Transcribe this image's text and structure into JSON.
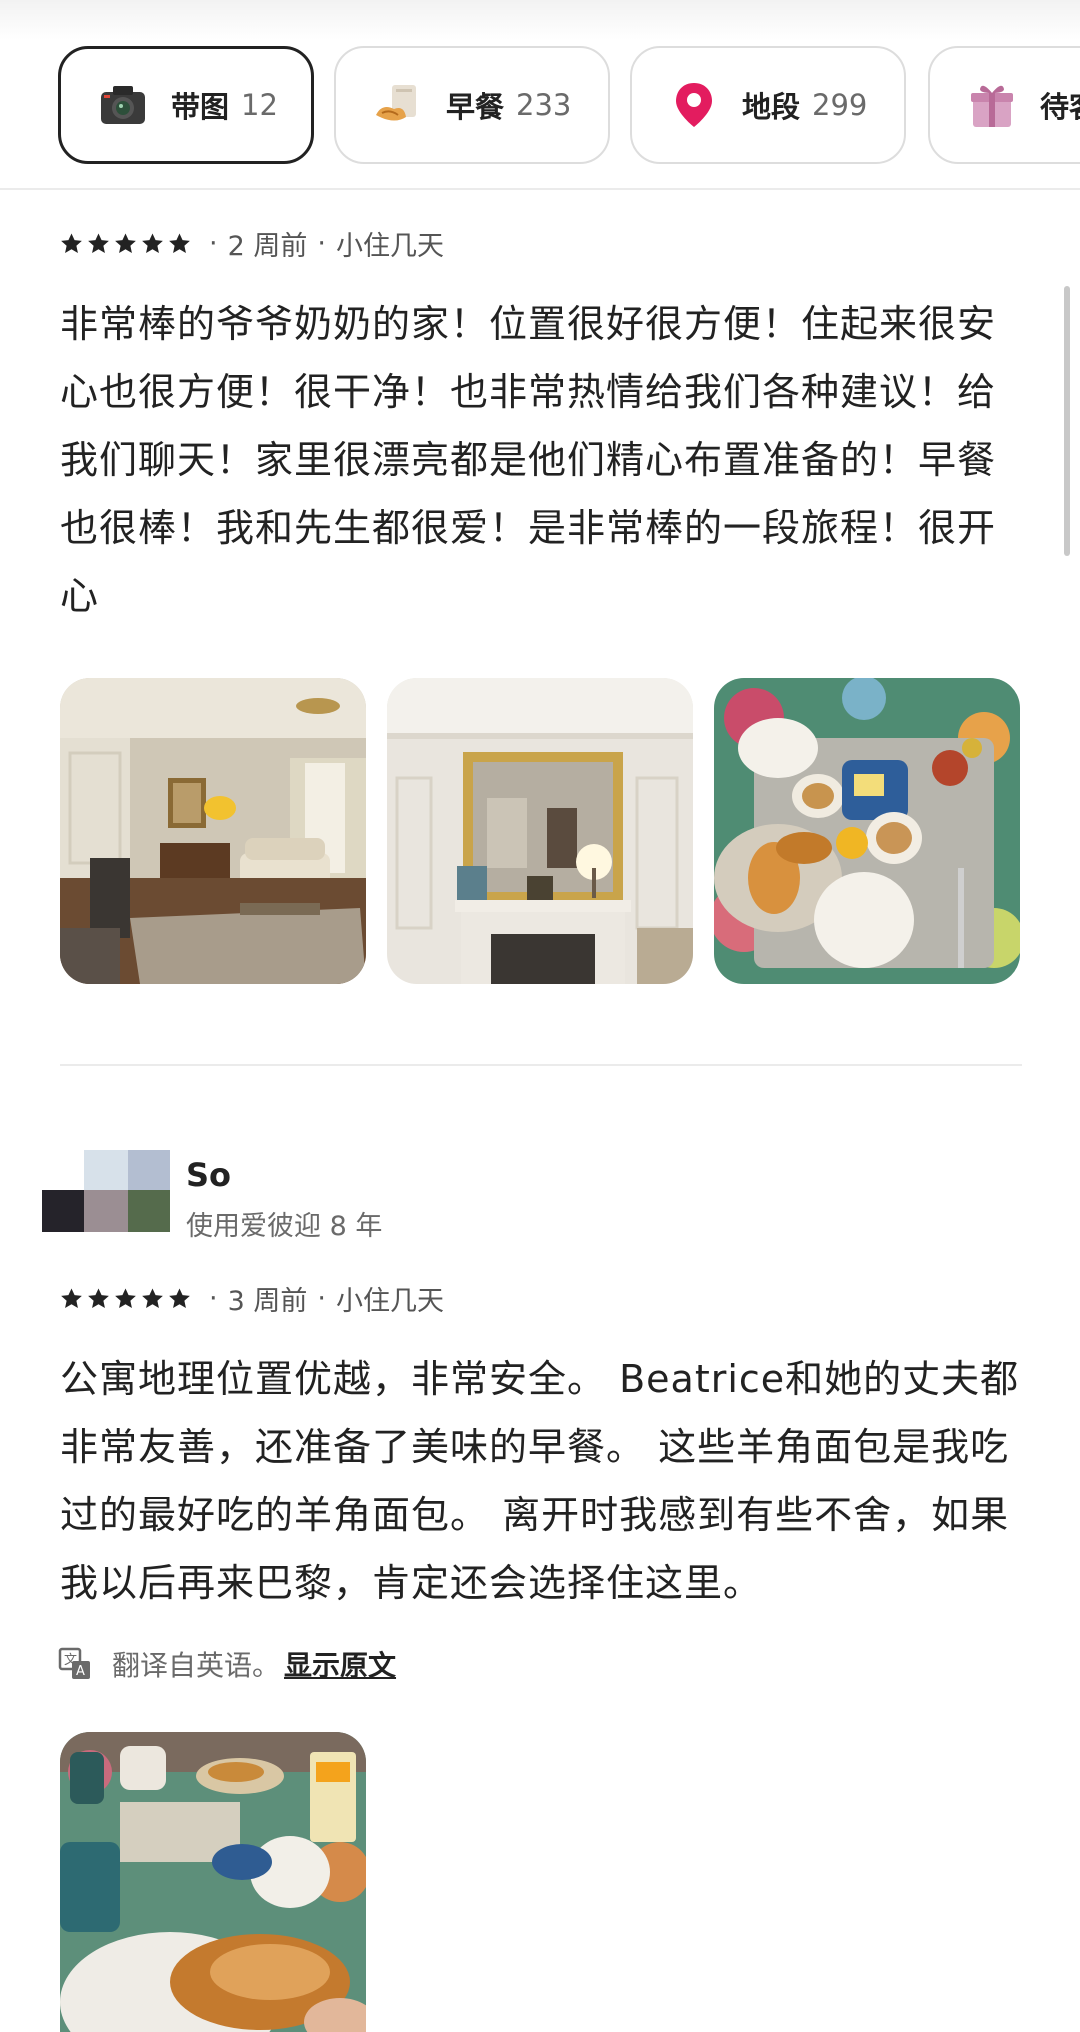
{
  "filters": [
    {
      "label": "带图",
      "count": "12",
      "icon": "camera-icon"
    },
    {
      "label": "早餐",
      "count": "233",
      "icon": "breakfast-icon"
    },
    {
      "label": "地段",
      "count": "299",
      "icon": "map-pin-icon"
    },
    {
      "label": "待客",
      "count": "",
      "icon": "gift-icon"
    }
  ],
  "reviews": [
    {
      "rating": 5,
      "time": "2 周前",
      "stay": "小住几天",
      "text": "非常棒的爷爷奶奶的家！位置很好很方便！住起来很安心也很方便！很干净！也非常热情给我们各种建议！给我们聊天！家里很漂亮都是他们精心布置准备的！早餐也很棒！我和先生都很爱！是非常棒的一段旅程！很开心"
    },
    {
      "reviewer": "So",
      "member_since": "使用爱彼迎 8 年",
      "rating": 5,
      "time": "3 周前",
      "stay": "小住几天",
      "text": "公寓地理位置优越，非常安全。 Beatrice和她的丈夫都非常友善，还准备了美味的早餐。 这些羊角面包是我吃过的最好吃的羊角面包。 离开时我感到有些不舍，如果我以后再来巴黎，肯定还会选择住这里。",
      "translated_note": "翻译自英语。",
      "show_original": "显示原文"
    }
  ],
  "colors": {
    "accent_pin": "#e31c5f",
    "text": "#222222",
    "muted": "#6a6a6a"
  }
}
